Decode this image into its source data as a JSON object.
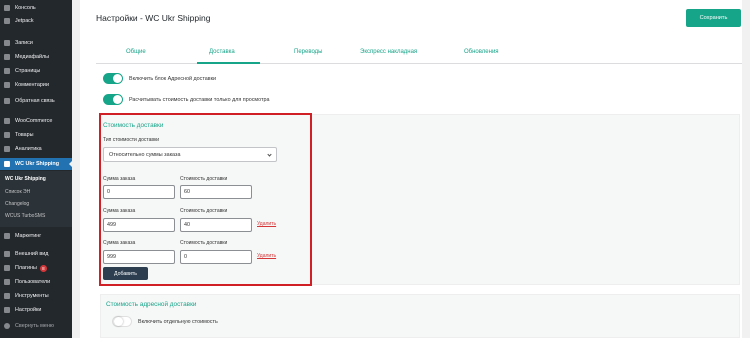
{
  "sidebar": {
    "items": [
      {
        "label": "Консоль",
        "icon": "dashboard-icon"
      },
      {
        "label": "Jetpack",
        "icon": "jetpack-icon"
      },
      {
        "label": "Записи",
        "icon": "posts-icon"
      },
      {
        "label": "Медиафайлы",
        "icon": "media-icon"
      },
      {
        "label": "Страницы",
        "icon": "pages-icon"
      },
      {
        "label": "Комментарии",
        "icon": "comments-icon"
      },
      {
        "label": "Обратная связь",
        "icon": "feedback-icon"
      },
      {
        "label": "WooCommerce",
        "icon": "woocommerce-icon"
      },
      {
        "label": "Товары",
        "icon": "products-icon"
      },
      {
        "label": "Аналитика",
        "icon": "analytics-icon"
      },
      {
        "label": "WC Ukr Shipping",
        "icon": "shipping-icon"
      }
    ],
    "submenu": [
      "WC Ukr Shipping",
      "Список ЭН",
      "Changelog",
      "WCUS TurboSMS"
    ],
    "items_after": [
      {
        "label": "Маркетинг",
        "icon": "marketing-icon"
      },
      {
        "label": "Внешний вид",
        "icon": "appearance-icon"
      },
      {
        "label": "Плагины",
        "icon": "plugins-icon",
        "badge": "8"
      },
      {
        "label": "Пользователи",
        "icon": "users-icon"
      },
      {
        "label": "Инструменты",
        "icon": "tools-icon"
      },
      {
        "label": "Настройки",
        "icon": "settings-icon"
      },
      {
        "label": "Свернуть меню",
        "icon": "collapse-icon"
      }
    ]
  },
  "header": {
    "title": "Настройки - WC Ukr Shipping",
    "save_label": "Сохранить"
  },
  "tabs": [
    "Общие",
    "Доставка",
    "Переводы",
    "Экспресс накладная",
    "Обновления"
  ],
  "active_tab": "Доставка",
  "toggles": {
    "address_block": "Включить блок Адресной доставки",
    "calc_cost": "Расчитывать стоимость доставки только для просмотра"
  },
  "delivery_cost": {
    "title": "Стоимость доставки",
    "type_label": "Тип стоимости доставки",
    "type_value": "Относительно суммы заказа",
    "order_sum_label": "Сумма заказа",
    "shipping_cost_label": "Стоимость доставки",
    "rows": [
      {
        "order_sum": "0",
        "cost": "60",
        "delete": ""
      },
      {
        "order_sum": "499",
        "cost": "40",
        "delete": "Удалить"
      },
      {
        "order_sum": "999",
        "cost": "0",
        "delete": "Удалить"
      }
    ],
    "add_label": "Добавить"
  },
  "address_cost": {
    "title": "Стоимость адресной доставки",
    "toggle_label": "Включить отдельную стоимость"
  },
  "colors": {
    "accent": "#17a589",
    "sidebar": "#23282d",
    "active_menu": "#2271b1",
    "highlight_frame": "#d11f26",
    "delete": "#d63638"
  }
}
